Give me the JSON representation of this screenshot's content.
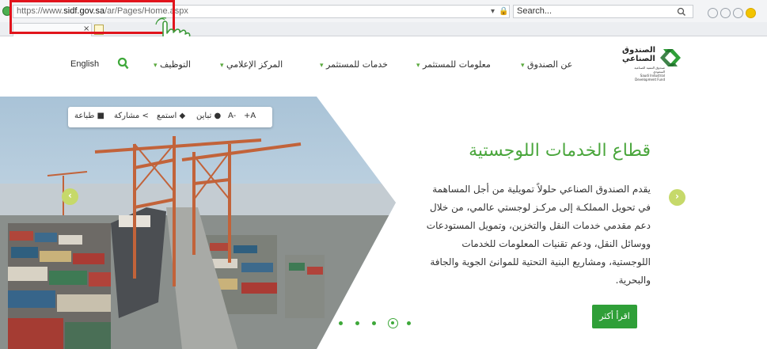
{
  "browser": {
    "url_prefix": "https://www.",
    "url_domain": "sidf.gov.sa",
    "url_path": "/ar/Pages/Home.aspx",
    "url_controls": "▾ 🔒 C",
    "search_placeholder": "Search...",
    "search_controls": "▾",
    "tab_close": "×"
  },
  "logo": {
    "line1": "الصندوق",
    "line2": "الصناعي",
    "subtitle_ar": "صندوق التنمية الصناعية السعودي",
    "subtitle_en": "Saudi Industrial Development Fund"
  },
  "nav": {
    "items": [
      {
        "label": "عن الصندوق"
      },
      {
        "label": "معلومات للمستثمر"
      },
      {
        "label": "خدمات للمستثمر"
      },
      {
        "label": "المركز الإعلامي"
      },
      {
        "label": "التوظيف"
      }
    ],
    "caret": "▾",
    "english": "English"
  },
  "tools": {
    "font_up": "+A",
    "font_down": "A-",
    "contrast": "تباين",
    "listen": "استمع",
    "share": "مشاركة",
    "print": "طباعة"
  },
  "hero": {
    "title": "قطاع الخدمات اللوجستية",
    "lines": [
      "يقدم الصندوق الصناعي حلولاً تمويلية من أجل المساهمة",
      "في تحويل المملكـة إلى مركـز لوجستي عالمي، من خلال",
      "دعم مقدمي خدمات النقل والتخزين، وتمويل المستودعات",
      "ووسائل النقل، ودعم تقنيات المعلومات للخدمات",
      "اللوجستية، ومشاريع البنية التحتية للموانئ الجوية والجافة",
      "والبحرية."
    ],
    "read_more": "اقرأ أكثر",
    "prev_arrow": "‹",
    "next_arrow": "›"
  },
  "carousel": {
    "total_slides": 5,
    "active_slide": 4
  },
  "colors": {
    "brand_green": "#3ea83a",
    "arrow_green": "#c6d96a",
    "highlight_red": "#e1141c"
  }
}
